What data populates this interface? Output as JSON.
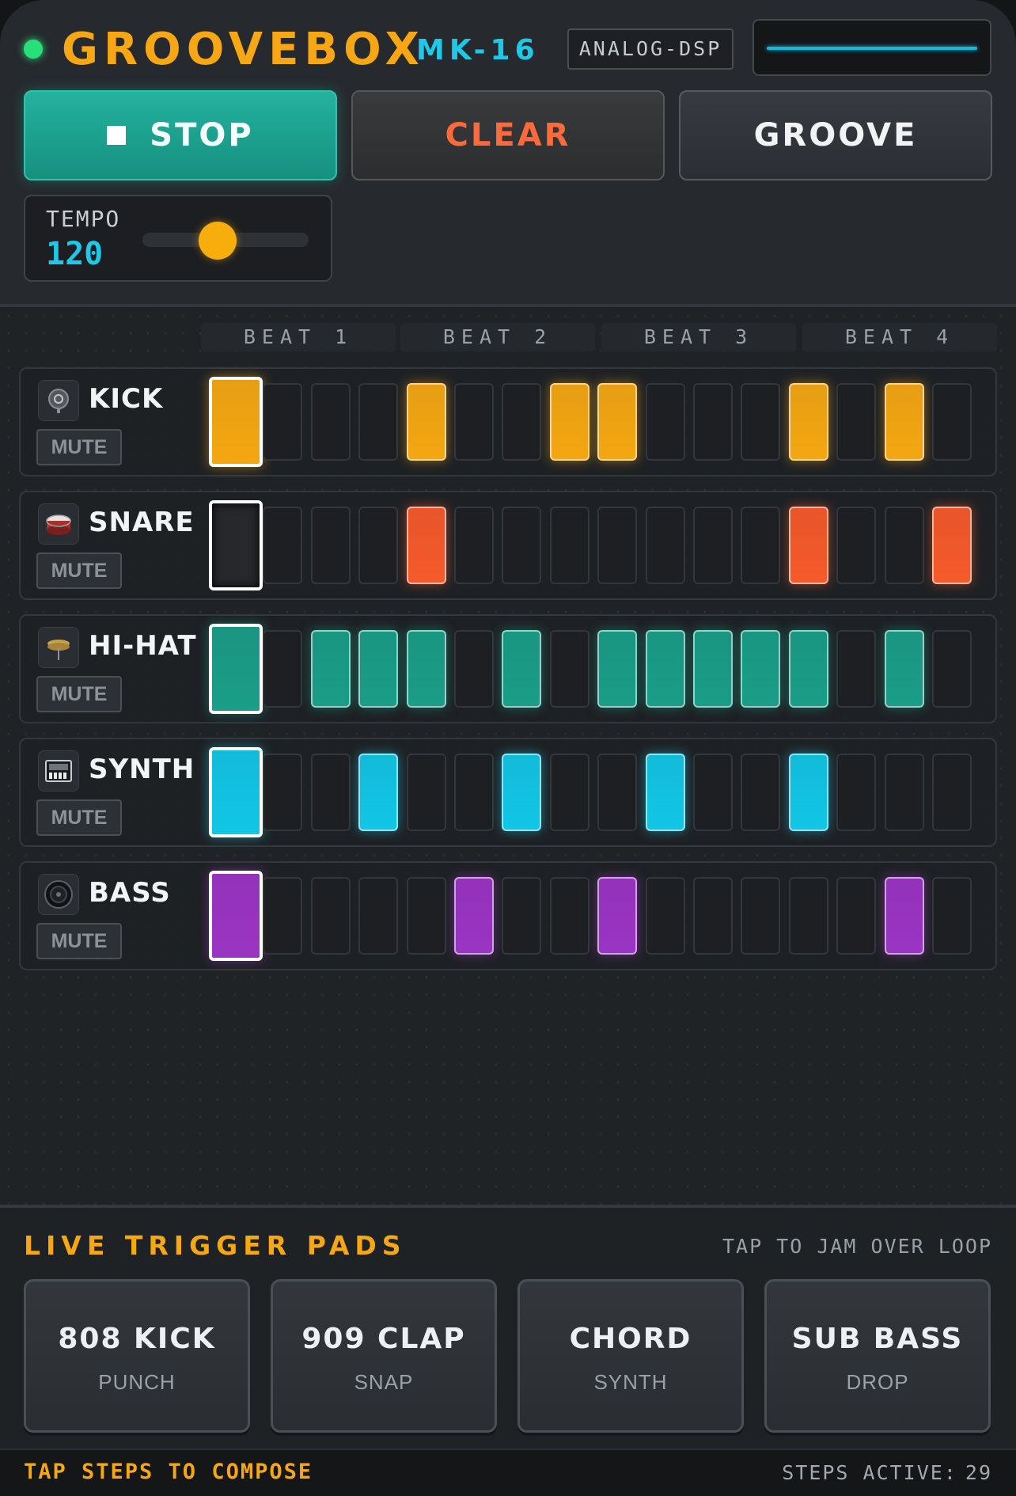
{
  "header": {
    "brand": "GROOVEBOX",
    "model": "MK-16",
    "engine_badge": "ANALOG-DSP",
    "power_led_color": "#28e07a",
    "scope_color": "#19b9d6"
  },
  "transport": {
    "stop_label": "STOP",
    "stop_icon": "stop-square-icon",
    "clear_label": "CLEAR",
    "groove_label": "GROOVE"
  },
  "tempo": {
    "label": "TEMPO",
    "value": "120",
    "slider_level": 0.45
  },
  "sequencer": {
    "beats": [
      "BEAT 1",
      "BEAT 2",
      "BEAT 3",
      "BEAT 4"
    ],
    "current_step": 1,
    "tracks": [
      {
        "name": "KICK",
        "icon": "kick-drum-icon",
        "mute_label": "MUTE",
        "color": "#f5a712",
        "steps": [
          1,
          0,
          0,
          0,
          1,
          0,
          0,
          1,
          1,
          0,
          0,
          0,
          1,
          0,
          1,
          0
        ]
      },
      {
        "name": "SNARE",
        "icon": "snare-drum-icon",
        "mute_label": "MUTE",
        "color": "#f65a2a",
        "steps": [
          0,
          0,
          0,
          0,
          1,
          0,
          0,
          0,
          0,
          0,
          0,
          0,
          1,
          0,
          0,
          1
        ]
      },
      {
        "name": "HI-HAT",
        "icon": "cymbal-icon",
        "mute_label": "MUTE",
        "color": "#1a9e88",
        "steps": [
          1,
          0,
          1,
          1,
          1,
          0,
          1,
          0,
          1,
          1,
          1,
          1,
          1,
          0,
          1,
          0
        ]
      },
      {
        "name": "SYNTH",
        "icon": "keyboard-icon",
        "mute_label": "MUTE",
        "color": "#12c6e6",
        "steps": [
          1,
          0,
          0,
          1,
          0,
          0,
          1,
          0,
          0,
          1,
          0,
          0,
          1,
          0,
          0,
          0
        ]
      },
      {
        "name": "BASS",
        "icon": "speaker-icon",
        "mute_label": "MUTE",
        "color": "#9b34c4",
        "steps": [
          1,
          0,
          0,
          0,
          0,
          1,
          0,
          0,
          1,
          0,
          0,
          0,
          0,
          0,
          1,
          0
        ]
      }
    ]
  },
  "live_pads": {
    "title": "LIVE TRIGGER PADS",
    "hint": "TAP TO JAM OVER LOOP",
    "pads": [
      {
        "name": "808 KICK",
        "sub": "PUNCH"
      },
      {
        "name": "909 CLAP",
        "sub": "SNAP"
      },
      {
        "name": "CHORD",
        "sub": "SYNTH"
      },
      {
        "name": "SUB BASS",
        "sub": "DROP"
      }
    ]
  },
  "footer": {
    "left": "TAP STEPS TO COMPOSE",
    "right_label": "STEPS ACTIVE:",
    "right_value": "29"
  }
}
